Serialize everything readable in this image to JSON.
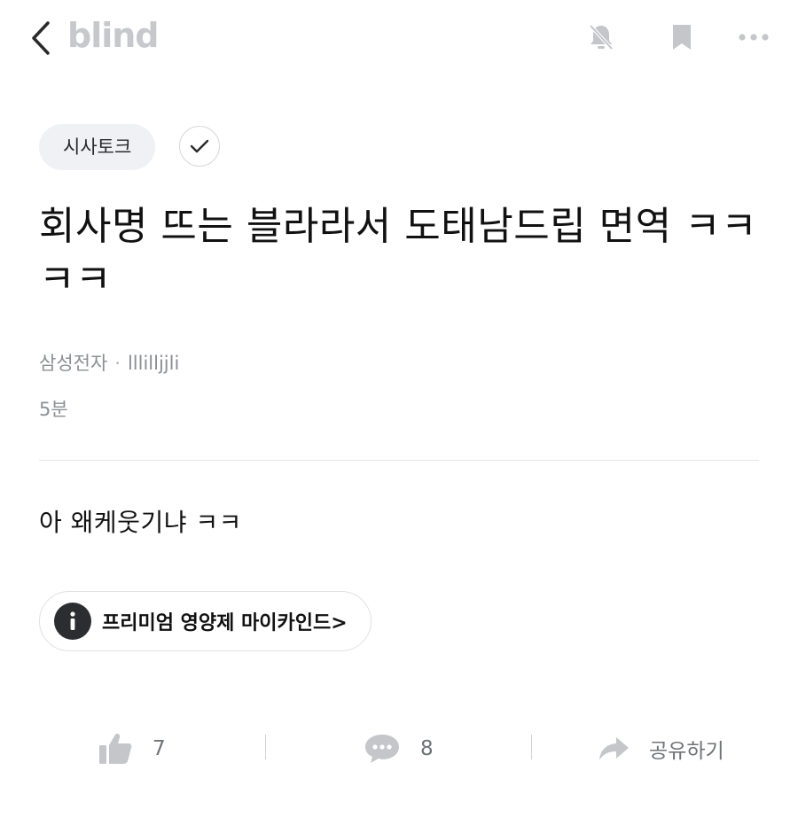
{
  "header": {
    "logo": "blind",
    "icons": [
      "back-arrow-icon",
      "bell-off-icon",
      "bookmark-icon",
      "more-icon"
    ]
  },
  "post": {
    "category": "시사토크",
    "title": "회사명 뜨는 블라라서 도태남드립 면역 ㅋㅋㅋㅋ",
    "company": "삼성전자",
    "separator": "·",
    "author": "lllilljjli",
    "time": "5분",
    "body": "아 왜케웃기냐 ㅋㅋ"
  },
  "ad": {
    "label": "프리미엄 영양제 마이카인드>"
  },
  "actions": {
    "likes": "7",
    "comments": "8",
    "share_label": "공유하기"
  },
  "colors": {
    "logo": "#c6c8cc",
    "icon_gray": "#c4c6ca",
    "meta_text": "#8c8f94",
    "tag_bg": "#eff1f5"
  }
}
